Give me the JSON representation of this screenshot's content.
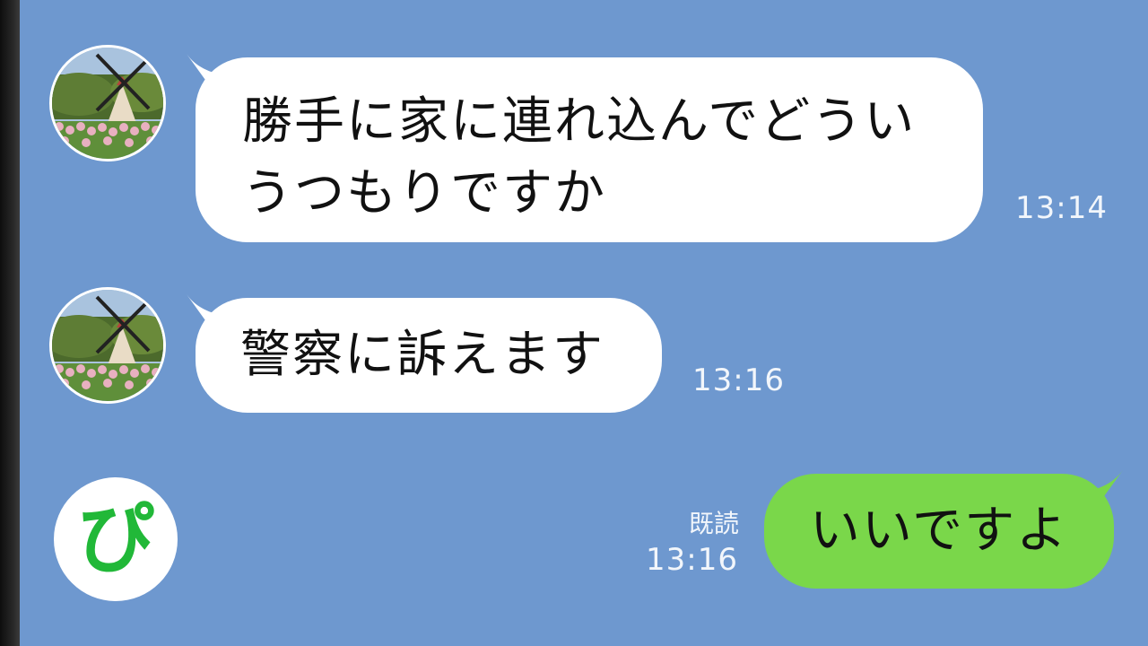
{
  "messages": [
    {
      "sender": "other",
      "lines": [
        "勝手に家に連れ込んでどうい",
        "うつもりですか"
      ],
      "time": "13:14"
    },
    {
      "sender": "other",
      "lines": [
        "警察に訴えます"
      ],
      "time": "13:16"
    },
    {
      "sender": "me",
      "lines": [
        "いいですよ"
      ],
      "time": "13:16",
      "read_label": "既読"
    }
  ],
  "logo": {
    "text": "ぴ"
  },
  "colors": {
    "background": "#6e98cf",
    "incoming_bubble": "#ffffff",
    "outgoing_bubble": "#7ad74a",
    "logo_green": "#21b838"
  },
  "icons": {
    "contact_avatar": "windmill-tulip-photo-avatar",
    "my_avatar": "pi-logo-avatar"
  }
}
